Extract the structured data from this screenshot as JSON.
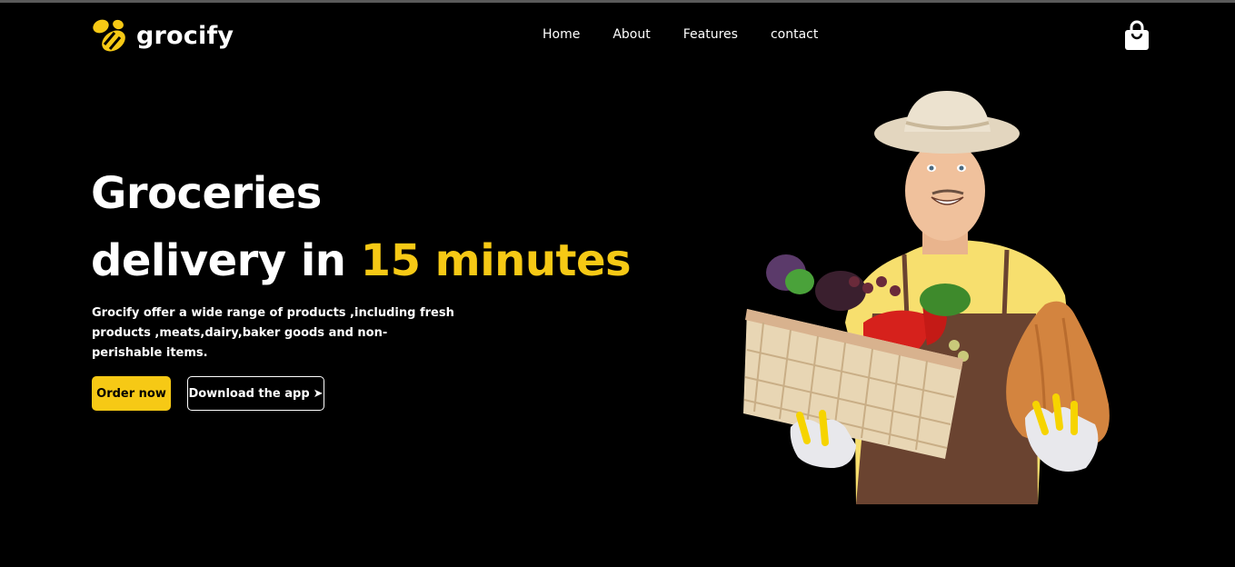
{
  "colors": {
    "background": "#000000",
    "accent": "#f6c915",
    "text": "#ffffff"
  },
  "header": {
    "logo_text": "grocify",
    "logo_icon": "bee-icon",
    "nav": [
      {
        "label": "Home"
      },
      {
        "label": "About"
      },
      {
        "label": "Features"
      },
      {
        "label": "contact"
      }
    ],
    "cart_icon": "shopping-bag-icon"
  },
  "hero": {
    "title_line1": "Groceries",
    "title_line2_prefix": "delivery in ",
    "title_line2_accent": "15 minutes",
    "description": "Grocify offer a wide range of products ,including fresh products ,meats,dairy,baker goods and non-perishable items.",
    "order_button": "Order now",
    "download_button": "Download the app",
    "download_icon": "arrow-right-icon",
    "image": "farmer-with-vegetable-basket-image"
  }
}
